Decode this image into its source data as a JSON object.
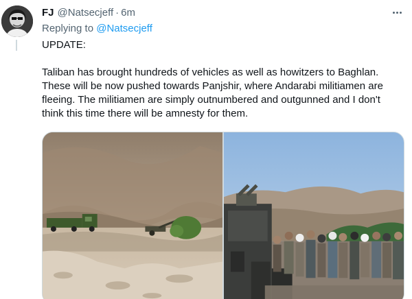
{
  "tweet": {
    "display_name": "FJ",
    "handle": "@Natsecjeff",
    "separator": "·",
    "time": "6m",
    "reply_prefix": "Replying to",
    "reply_to": "@Natsecjeff",
    "text_line1": "UPDATE:",
    "text_line2": "Taliban has brought hundreds of vehicles as well as howitzers to Baghlan. These will be now pushed towards Panjshir, where Andarabi militiamen are fleeing. The militiamen are simply outnumbered and outgunned and I don't think this time there will be amnesty for them."
  },
  "icons": {
    "more": "more-horizontal-icon"
  },
  "colors": {
    "link": "#1d9bf0",
    "secondary_text": "#536471",
    "primary_text": "#0f1419"
  }
}
